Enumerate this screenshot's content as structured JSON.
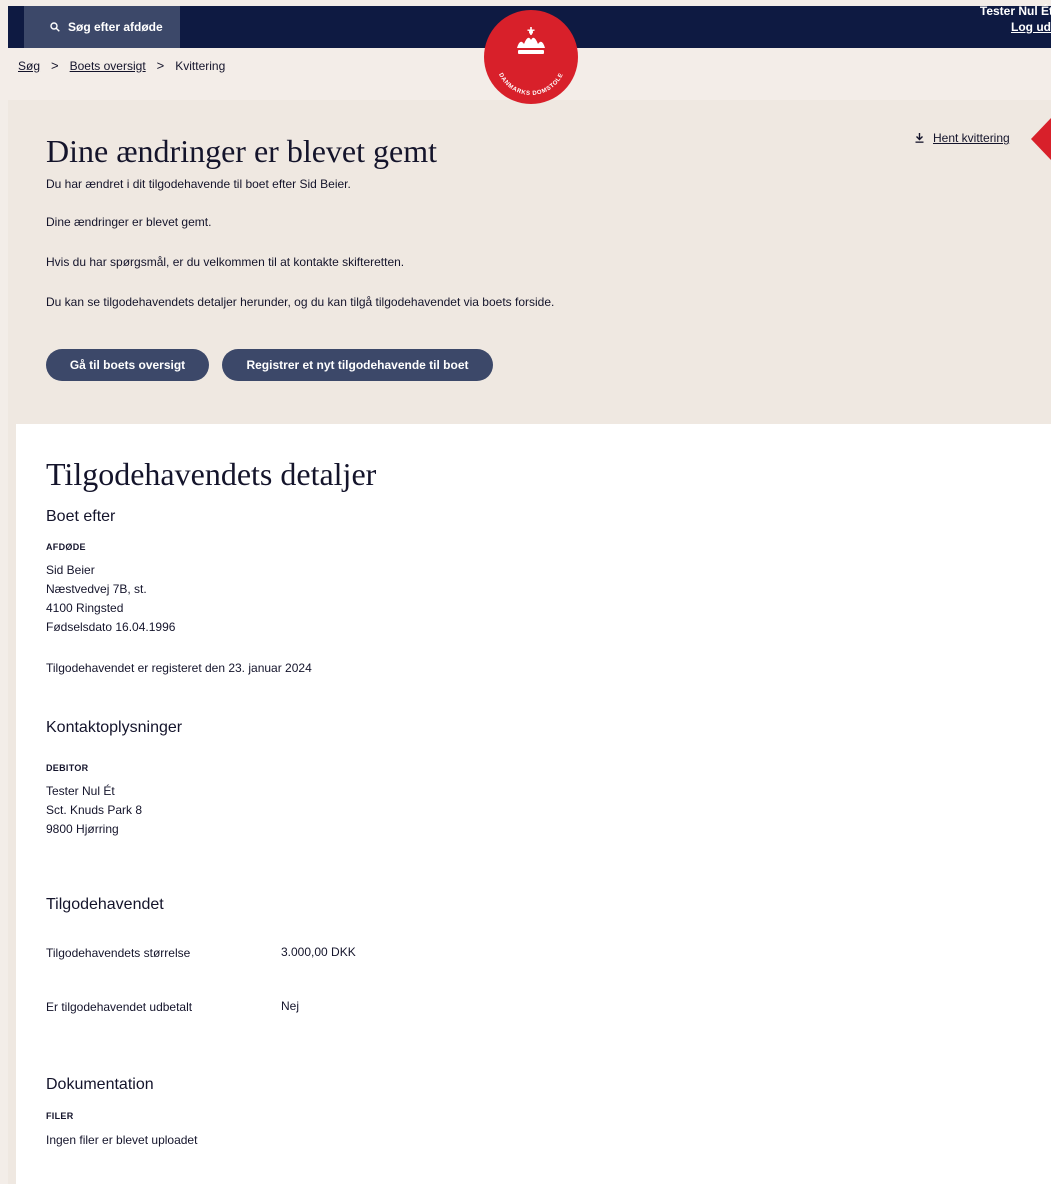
{
  "header": {
    "search_label": "Søg efter afdøde",
    "user_name": "Tester Nul Ét",
    "logout_label": "Log ud",
    "logo_text": "DANMARKS DOMSTOLE",
    "brand_color": "#d8202a",
    "nav_bg": "#0e1a42"
  },
  "breadcrumb": {
    "items": [
      "Søg",
      "Boets oversigt",
      "Kvittering"
    ],
    "separator": ">"
  },
  "receipt": {
    "title": "Dine ændringer er blevet gemt",
    "download_label": "Hent kvittering",
    "paragraphs": [
      "Du har ændret i dit tilgodehavende til boet efter Sid Beier.",
      "Dine ændringer er blevet gemt.",
      "Hvis du har spørgsmål, er du velkommen til at kontakte skifteretten.",
      "Du kan se tilgodehavendets detaljer herunder, og du kan tilgå tilgodehavendet via boets forside."
    ],
    "buttons": {
      "overview": "Gå til boets oversigt",
      "register": "Registrer et nyt tilgodehavende til boet"
    }
  },
  "details": {
    "title": "Tilgodehavendets detaljer",
    "estate": {
      "heading": "Boet efter",
      "caption": "AFDØDE",
      "lines": [
        "Sid Beier",
        "Næstvedvej 7B, st.",
        "4100 Ringsted",
        "Fødselsdato 16.04.1996"
      ],
      "registered": "Tilgodehavendet er registeret den 23. januar 2024"
    },
    "contact": {
      "heading": "Kontaktoplysninger",
      "caption": "DEBITOR",
      "lines": [
        "Tester Nul Ét",
        "Sct. Knuds Park 8",
        "9800 Hjørring"
      ]
    },
    "claim": {
      "heading": "Tilgodehavendet",
      "size_label": "Tilgodehavendets størrelse",
      "size_value": "3.000,00 DKK",
      "paid_label": "Er tilgodehavendet udbetalt",
      "paid_value": "Nej"
    },
    "docs": {
      "heading": "Dokumentation",
      "caption": "FILER",
      "text": "Ingen filer er blevet uploadet"
    }
  }
}
